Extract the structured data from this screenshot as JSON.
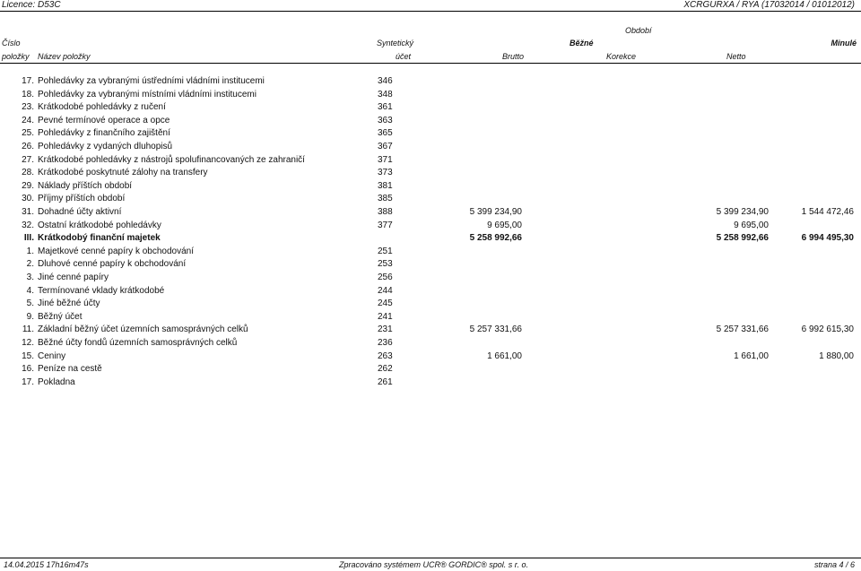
{
  "page": {
    "licence": "Licence: D53C",
    "report_ref": "XCRGURXA / RYA  (17032014 / 01012012)"
  },
  "header": {
    "obdobi": "Období",
    "cislo": "Číslo",
    "syntet": "Syntetický",
    "bezne": "Běžné",
    "minule": "Minulé",
    "polozky": "položky",
    "nazev": "Název položky",
    "ucet": "účet",
    "brutto": "Brutto",
    "korekce": "Korekce",
    "netto": "Netto"
  },
  "rows": [
    {
      "num": "17.",
      "name": "Pohledávky za vybranými ústředními vládními institucemi",
      "code": "346",
      "brutto": "",
      "netto": "",
      "minule": "",
      "bold": false
    },
    {
      "num": "18.",
      "name": "Pohledávky za vybranými místními vládními institucemi",
      "code": "348",
      "brutto": "",
      "netto": "",
      "minule": "",
      "bold": false
    },
    {
      "num": "23.",
      "name": "Krátkodobé pohledávky z ručení",
      "code": "361",
      "brutto": "",
      "netto": "",
      "minule": "",
      "bold": false
    },
    {
      "num": "24.",
      "name": "Pevné termínové operace a opce",
      "code": "363",
      "brutto": "",
      "netto": "",
      "minule": "",
      "bold": false
    },
    {
      "num": "25.",
      "name": "Pohledávky z finančního zajištění",
      "code": "365",
      "brutto": "",
      "netto": "",
      "minule": "",
      "bold": false
    },
    {
      "num": "26.",
      "name": "Pohledávky z vydaných dluhopisů",
      "code": "367",
      "brutto": "",
      "netto": "",
      "minule": "",
      "bold": false
    },
    {
      "num": "27.",
      "name": "Krátkodobé pohledávky z nástrojů spolufinancovaných ze zahraničí",
      "code": "371",
      "brutto": "",
      "netto": "",
      "minule": "",
      "bold": false
    },
    {
      "num": "28.",
      "name": "Krátkodobé poskytnuté zálohy na transfery",
      "code": "373",
      "brutto": "",
      "netto": "",
      "minule": "",
      "bold": false
    },
    {
      "num": "29.",
      "name": "Náklady příštích období",
      "code": "381",
      "brutto": "",
      "netto": "",
      "minule": "",
      "bold": false
    },
    {
      "num": "30.",
      "name": "Příjmy příštích období",
      "code": "385",
      "brutto": "",
      "netto": "",
      "minule": "",
      "bold": false
    },
    {
      "num": "31.",
      "name": "Dohadné účty aktivní",
      "code": "388",
      "brutto": "5 399 234,90",
      "netto": "5 399 234,90",
      "minule": "1 544 472,46",
      "bold": false
    },
    {
      "num": "32.",
      "name": "Ostatní krátkodobé pohledávky",
      "code": "377",
      "brutto": "9 695,00",
      "netto": "9 695,00",
      "minule": "",
      "bold": false
    },
    {
      "num": "III.",
      "name": "Krátkodobý finanční majetek",
      "code": "",
      "brutto": "5 258 992,66",
      "netto": "5 258 992,66",
      "minule": "6 994 495,30",
      "bold": true
    },
    {
      "num": "1.",
      "name": "Majetkové cenné papíry k obchodování",
      "code": "251",
      "brutto": "",
      "netto": "",
      "minule": "",
      "bold": false
    },
    {
      "num": "2.",
      "name": "Dluhové cenné papíry k obchodování",
      "code": "253",
      "brutto": "",
      "netto": "",
      "minule": "",
      "bold": false
    },
    {
      "num": "3.",
      "name": "Jiné cenné papíry",
      "code": "256",
      "brutto": "",
      "netto": "",
      "minule": "",
      "bold": false
    },
    {
      "num": "4.",
      "name": "Termínované vklady krátkodobé",
      "code": "244",
      "brutto": "",
      "netto": "",
      "minule": "",
      "bold": false
    },
    {
      "num": "5.",
      "name": "Jiné běžné účty",
      "code": "245",
      "brutto": "",
      "netto": "",
      "minule": "",
      "bold": false
    },
    {
      "num": "9.",
      "name": "Běžný účet",
      "code": "241",
      "brutto": "",
      "netto": "",
      "minule": "",
      "bold": false
    },
    {
      "num": "11.",
      "name": "Základní běžný účet územních samosprávných celků",
      "code": "231",
      "brutto": "5 257 331,66",
      "netto": "5 257 331,66",
      "minule": "6 992 615,30",
      "bold": false
    },
    {
      "num": "12.",
      "name": "Běžné účty fondů územních samosprávných celků",
      "code": "236",
      "brutto": "",
      "netto": "",
      "minule": "",
      "bold": false
    },
    {
      "num": "15.",
      "name": "Ceniny",
      "code": "263",
      "brutto": "1 661,00",
      "netto": "1 661,00",
      "minule": "1 880,00",
      "bold": false
    },
    {
      "num": "16.",
      "name": "Peníze na cestě",
      "code": "262",
      "brutto": "",
      "netto": "",
      "minule": "",
      "bold": false
    },
    {
      "num": "17.",
      "name": "Pokladna",
      "code": "261",
      "brutto": "",
      "netto": "",
      "minule": "",
      "bold": false
    }
  ],
  "footer": {
    "timestamp": "14.04.2015 17h16m47s",
    "system": "Zpracováno systémem UCR® GORDIC® spol. s r. o.",
    "page": "strana 4 / 6"
  }
}
